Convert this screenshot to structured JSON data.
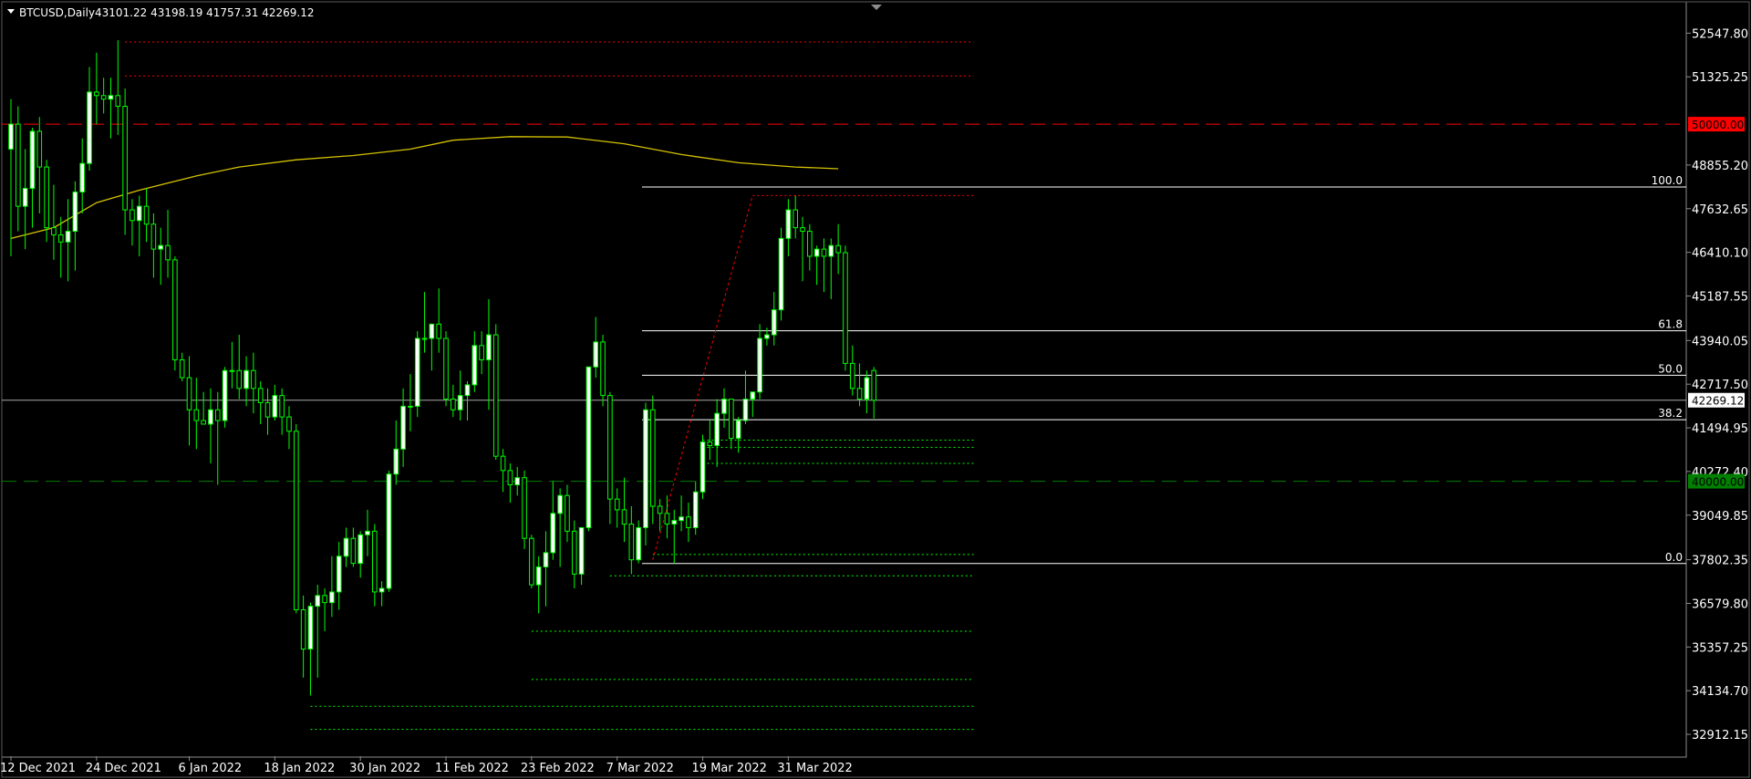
{
  "header": {
    "symbol": "BTCUSD,Daily",
    "ohlc": "43101.22 43198.19 41757.31 42269.12"
  },
  "chart_data": {
    "type": "candlestick",
    "symbol": "BTCUSD",
    "timeframe": "Daily",
    "ylim": [
      32300,
      53400
    ],
    "y_ticks": [
      52547.8,
      51325.25,
      48855.2,
      47632.65,
      46410.1,
      45187.55,
      43940.05,
      42717.5,
      41494.95,
      40272.4,
      39049.85,
      37802.35,
      36579.8,
      35357.25,
      34134.7,
      32912.15
    ],
    "y_tick_labels": [
      "52547.80",
      "51325.25",
      "48855.20",
      "47632.65",
      "46410.10",
      "45187.55",
      "43940.05",
      "42717.50",
      "41494.95",
      "40272.40",
      "39049.85",
      "37802.35",
      "36579.80",
      "35357.25",
      "34134.70",
      "32912.15"
    ],
    "x_tick_labels": [
      "12 Dec 2021",
      "24 Dec 2021",
      "6 Jan 2022",
      "18 Jan 2022",
      "30 Jan 2022",
      "11 Feb 2022",
      "23 Feb 2022",
      "7 Mar 2022",
      "19 Mar 2022",
      "31 Mar 2022"
    ],
    "x_tick_index": [
      0,
      12,
      25,
      37,
      49,
      61,
      73,
      85,
      97,
      109
    ],
    "colors": {
      "bull": "#ffffff",
      "bear": "#000000",
      "wick": "#00ff00",
      "ma": "#d4c200",
      "level_red": "#ff0000",
      "level_green": "#008000",
      "fib": "#ffffff",
      "trend": "#ff0000",
      "grid_price": "#a9a9a9"
    },
    "candles": [
      [
        49300,
        50700,
        46300,
        50000
      ],
      [
        50000,
        50500,
        47000,
        47700
      ],
      [
        47700,
        49300,
        46500,
        48200
      ],
      [
        48200,
        49900,
        47100,
        49800
      ],
      [
        49800,
        50200,
        47500,
        48800
      ],
      [
        48800,
        49000,
        46700,
        47100
      ],
      [
        47100,
        48300,
        46200,
        46900
      ],
      [
        46900,
        47400,
        45700,
        46700
      ],
      [
        46700,
        47900,
        45600,
        47000
      ],
      [
        47000,
        48400,
        45900,
        48100
      ],
      [
        48100,
        49600,
        47500,
        48900
      ],
      [
        48900,
        51600,
        48700,
        50900
      ],
      [
        50900,
        52000,
        50000,
        50800
      ],
      [
        50800,
        51300,
        50300,
        50700
      ],
      [
        50700,
        51300,
        49600,
        50800
      ],
      [
        50800,
        52350,
        49700,
        50500
      ],
      [
        50500,
        51000,
        46900,
        47600
      ],
      [
        47600,
        47900,
        46600,
        47300
      ],
      [
        47300,
        48000,
        46300,
        47700
      ],
      [
        47700,
        48200,
        46700,
        47200
      ],
      [
        47200,
        47500,
        45700,
        46500
      ],
      [
        46500,
        47100,
        45500,
        46600
      ],
      [
        46600,
        47600,
        45700,
        46200
      ],
      [
        46200,
        46300,
        43100,
        43400
      ],
      [
        43400,
        43600,
        42800,
        42900
      ],
      [
        42900,
        43500,
        41000,
        42000
      ],
      [
        42000,
        42900,
        40900,
        41700
      ],
      [
        41700,
        42500,
        41600,
        41600
      ],
      [
        41600,
        42600,
        40500,
        42000
      ],
      [
        42000,
        42500,
        39900,
        41700
      ],
      [
        41700,
        43200,
        41500,
        43100
      ],
      [
        43100,
        43900,
        42600,
        43100
      ],
      [
        43100,
        44100,
        42300,
        42600
      ],
      [
        42600,
        43500,
        42100,
        43100
      ],
      [
        43100,
        43600,
        41900,
        42600
      ],
      [
        42600,
        42800,
        41600,
        42200
      ],
      [
        42200,
        42600,
        41300,
        41800
      ],
      [
        41800,
        42700,
        41700,
        42400
      ],
      [
        42400,
        42600,
        41300,
        41800
      ],
      [
        41800,
        42100,
        40900,
        41400
      ],
      [
        41400,
        41600,
        36300,
        36400
      ],
      [
        36400,
        36800,
        34500,
        35300
      ],
      [
        35300,
        36600,
        34000,
        36500
      ],
      [
        36500,
        37100,
        34500,
        36800
      ],
      [
        36800,
        37000,
        35800,
        36600
      ],
      [
        36600,
        37900,
        36200,
        36900
      ],
      [
        36900,
        38300,
        36400,
        37900
      ],
      [
        37900,
        38700,
        37600,
        38400
      ],
      [
        38400,
        38700,
        37600,
        37700
      ],
      [
        37700,
        38600,
        37300,
        38500
      ],
      [
        38500,
        39200,
        37900,
        38600
      ],
      [
        38600,
        38800,
        36500,
        36900
      ],
      [
        36900,
        37200,
        36500,
        37000
      ],
      [
        37000,
        40300,
        36900,
        40200
      ],
      [
        40200,
        41700,
        39900,
        40900
      ],
      [
        40900,
        42600,
        40400,
        42100
      ],
      [
        42100,
        43000,
        41400,
        42100
      ],
      [
        42100,
        44200,
        41800,
        44000
      ],
      [
        44000,
        45300,
        43600,
        44000
      ],
      [
        44000,
        44400,
        43100,
        44400
      ],
      [
        44400,
        45400,
        43600,
        44000
      ],
      [
        44000,
        44200,
        42100,
        42300
      ],
      [
        42300,
        42700,
        41800,
        42000
      ],
      [
        42000,
        43100,
        41700,
        42400
      ],
      [
        42400,
        42800,
        41700,
        42700
      ],
      [
        42700,
        44200,
        42500,
        43800
      ],
      [
        43800,
        44200,
        43000,
        43400
      ],
      [
        43400,
        45100,
        42000,
        44100
      ],
      [
        44100,
        44400,
        40600,
        40700
      ],
      [
        40700,
        40900,
        39700,
        40300
      ],
      [
        40300,
        40500,
        39400,
        39900
      ],
      [
        39900,
        40400,
        39600,
        40100
      ],
      [
        40100,
        40300,
        38100,
        38400
      ],
      [
        38400,
        38500,
        37000,
        37100
      ],
      [
        37100,
        37900,
        36300,
        37600
      ],
      [
        37600,
        38600,
        36500,
        38000
      ],
      [
        38000,
        40000,
        37800,
        39100
      ],
      [
        39100,
        39800,
        37600,
        39600
      ],
      [
        39600,
        39900,
        38300,
        38600
      ],
      [
        38600,
        38900,
        37000,
        37400
      ],
      [
        37400,
        38600,
        37100,
        38700
      ],
      [
        38700,
        42000,
        38600,
        43200
      ],
      [
        43200,
        44600,
        42900,
        43900
      ],
      [
        43900,
        44100,
        42100,
        42400
      ],
      [
        42400,
        42500,
        38800,
        39500
      ],
      [
        39500,
        39800,
        38700,
        39200
      ],
      [
        39200,
        40100,
        38300,
        38800
      ],
      [
        38800,
        39300,
        37400,
        37800
      ],
      [
        37800,
        38900,
        37700,
        38700
      ],
      [
        38700,
        42200,
        38200,
        42000
      ],
      [
        42000,
        42400,
        38800,
        39300
      ],
      [
        39300,
        39500,
        38600,
        39100
      ],
      [
        39100,
        39600,
        38400,
        38800
      ],
      [
        38800,
        39200,
        37700,
        38900
      ],
      [
        38900,
        39600,
        38600,
        39000
      ],
      [
        39000,
        39400,
        38300,
        38700
      ],
      [
        38700,
        40000,
        38500,
        39700
      ],
      [
        39700,
        41300,
        39500,
        41100
      ],
      [
        41100,
        41700,
        40600,
        41000
      ],
      [
        41000,
        42300,
        40400,
        41900
      ],
      [
        41900,
        42600,
        41500,
        42300
      ],
      [
        42300,
        42300,
        40900,
        41200
      ],
      [
        41200,
        41800,
        40800,
        41700
      ],
      [
        41700,
        43100,
        41600,
        42300
      ],
      [
        42300,
        42500,
        41800,
        42500
      ],
      [
        42500,
        44400,
        42300,
        44000
      ],
      [
        44000,
        44300,
        43800,
        44100
      ],
      [
        44100,
        45300,
        43800,
        44800
      ],
      [
        44800,
        47100,
        44500,
        46800
      ],
      [
        46800,
        47900,
        46300,
        47600
      ],
      [
        47600,
        48000,
        46800,
        47100
      ],
      [
        47100,
        47400,
        45600,
        47000
      ],
      [
        47000,
        47200,
        45900,
        46300
      ],
      [
        46300,
        46600,
        45500,
        46500
      ],
      [
        46500,
        46800,
        45300,
        46300
      ],
      [
        46300,
        46800,
        45100,
        46600
      ],
      [
        46600,
        47200,
        45800,
        46400
      ],
      [
        46400,
        46600,
        43100,
        43300
      ],
      [
        43300,
        43800,
        42400,
        42600
      ],
      [
        42600,
        43300,
        42100,
        42300
      ],
      [
        42300,
        43100,
        41900,
        42900
      ],
      [
        43101.22,
        43198.19,
        41757.31,
        42269.12
      ]
    ],
    "moving_average": [
      [
        0,
        46800
      ],
      [
        6,
        47100
      ],
      [
        12,
        47800
      ],
      [
        18,
        48150
      ],
      [
        26,
        48550
      ],
      [
        32,
        48800
      ],
      [
        40,
        49000
      ],
      [
        48,
        49120
      ],
      [
        56,
        49300
      ],
      [
        62,
        49550
      ],
      [
        70,
        49650
      ],
      [
        78,
        49640
      ],
      [
        86,
        49450
      ],
      [
        94,
        49150
      ],
      [
        102,
        48920
      ],
      [
        110,
        48800
      ],
      [
        116,
        48750
      ]
    ],
    "price_levels": [
      {
        "price": 50000,
        "label": "50000.00",
        "color": "red",
        "style": "dashed"
      },
      {
        "price": 40000,
        "label": "40000.00",
        "color": "green",
        "style": "dashed"
      },
      {
        "price": 42269.12,
        "label": "42269.12",
        "color": "current",
        "style": "solid"
      }
    ],
    "fibonacci": {
      "start_index": 89,
      "end_index": 115,
      "low": 37696,
      "high": 48240,
      "levels": [
        {
          "ratio": 1.0,
          "label": "100.0"
        },
        {
          "ratio": 0.618,
          "label": "61.8"
        },
        {
          "ratio": 0.5,
          "label": "50.0"
        },
        {
          "ratio": 0.382,
          "label": "38.2"
        },
        {
          "ratio": 0.0,
          "label": "0.0"
        }
      ]
    },
    "trendline": {
      "from": [
        90,
        37800
      ],
      "to": [
        104,
        48000
      ]
    },
    "red_dotted_levels": [
      {
        "from": 16,
        "to": 135,
        "price": 52300
      },
      {
        "from": 16,
        "to": 135,
        "price": 51350
      },
      {
        "from": 104,
        "to": 135,
        "price": 48000
      }
    ],
    "green_dotted_levels": [
      {
        "from": 97,
        "to": 135,
        "price": 41150
      },
      {
        "from": 97,
        "to": 135,
        "price": 40950
      },
      {
        "from": 97,
        "to": 135,
        "price": 40500
      },
      {
        "from": 90,
        "to": 135,
        "price": 37950
      },
      {
        "from": 84,
        "to": 135,
        "price": 37350
      },
      {
        "from": 73,
        "to": 135,
        "price": 35800
      },
      {
        "from": 73,
        "to": 135,
        "price": 34450
      },
      {
        "from": 42,
        "to": 135,
        "price": 33700
      },
      {
        "from": 42,
        "to": 135,
        "price": 33050
      }
    ]
  }
}
